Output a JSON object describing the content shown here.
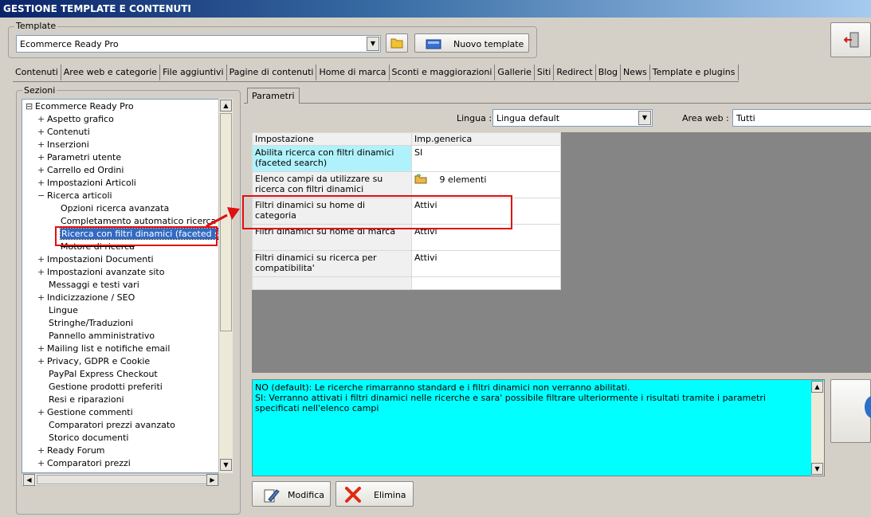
{
  "window": {
    "title": "GESTIONE TEMPLATE E CONTENUTI"
  },
  "template": {
    "group_label": "Template",
    "selected": "Ecommerce Ready Pro",
    "new_button": "Nuovo template"
  },
  "tabs": [
    "Contenuti",
    "Aree web e categorie",
    "File aggiuntivi",
    "Pagine di contenuti",
    "Home di marca",
    "Sconti e maggiorazioni",
    "Gallerie",
    "Siti",
    "Redirect",
    "Blog",
    "News",
    "Template e plugins"
  ],
  "sections": {
    "label": "Sezioni",
    "tree": [
      {
        "label": "Ecommerce Ready Pro",
        "expander": "⊟"
      },
      {
        "label": "Aspetto grafico",
        "expander": "+"
      },
      {
        "label": "Contenuti",
        "expander": "+"
      },
      {
        "label": "Inserzioni",
        "expander": "+"
      },
      {
        "label": "Parametri utente",
        "expander": "+"
      },
      {
        "label": "Carrello ed Ordini",
        "expander": "+"
      },
      {
        "label": "Impostazioni Articoli",
        "expander": "+"
      },
      {
        "label": "Ricerca articoli",
        "expander": "−"
      },
      {
        "label": "Opzioni ricerca avanzata",
        "expander": ""
      },
      {
        "label": "Completamento automatico ricerca",
        "expander": ""
      },
      {
        "label": "Ricerca con filtri dinamici (faceted search)",
        "expander": ""
      },
      {
        "label": "Motore di ricerca",
        "expander": ""
      },
      {
        "label": "Impostazioni Documenti",
        "expander": "+"
      },
      {
        "label": "Impostazioni avanzate sito",
        "expander": "+"
      },
      {
        "label": "Messaggi e testi vari",
        "expander": ""
      },
      {
        "label": "Indicizzazione / SEO",
        "expander": "+"
      },
      {
        "label": "Lingue",
        "expander": ""
      },
      {
        "label": "Stringhe/Traduzioni",
        "expander": ""
      },
      {
        "label": "Pannello amministrativo",
        "expander": ""
      },
      {
        "label": "Mailing list e notifiche email",
        "expander": "+"
      },
      {
        "label": "Privacy, GDPR e Cookie",
        "expander": "+"
      },
      {
        "label": "PayPal Express Checkout",
        "expander": ""
      },
      {
        "label": "Gestione prodotti preferiti",
        "expander": ""
      },
      {
        "label": "Resi e riparazioni",
        "expander": ""
      },
      {
        "label": "Gestione commenti",
        "expander": "+"
      },
      {
        "label": "Comparatori prezzi avanzato",
        "expander": ""
      },
      {
        "label": "Storico documenti",
        "expander": ""
      },
      {
        "label": "Ready Forum",
        "expander": "+"
      },
      {
        "label": "Comparatori prezzi",
        "expander": "+"
      }
    ]
  },
  "params": {
    "tab": "Parametri",
    "language_label": "Lingua :",
    "language_value": "Lingua default",
    "area_label": "Area web :",
    "area_value": "Tutti",
    "columns": [
      "Impostazione",
      "Imp.generica"
    ],
    "rows": [
      {
        "setting": "Abilita ricerca con filtri dinamici (faceted search)",
        "value": "SI"
      },
      {
        "setting": "Elenco campi da utilizzare su ricerca con filtri dinamici",
        "value": "9 elementi"
      },
      {
        "setting": "Filtri dinamici su home di categoria",
        "value": "Attivi"
      },
      {
        "setting": "Filtri dinamici su home di marca",
        "value": "Attivi"
      },
      {
        "setting": "Filtri dinamici su ricerca per compatibilita'",
        "value": "Attivi"
      }
    ],
    "description_line1": "NO (default): Le ricerche rimarranno standard e i filtri dinamici non verranno abilitati.",
    "description_line2": "SI: Verranno attivati i filtri dinamici nelle ricerche e sara' possibile filtrare ulteriormente i risultati tramite i parametri specificati nell'elenco campi"
  },
  "buttons": {
    "edit": "Modifica",
    "delete": "Elimina"
  },
  "colors": {
    "highlight": "#e01010",
    "description_bg": "#00ffff",
    "selection": "#316ac5"
  }
}
